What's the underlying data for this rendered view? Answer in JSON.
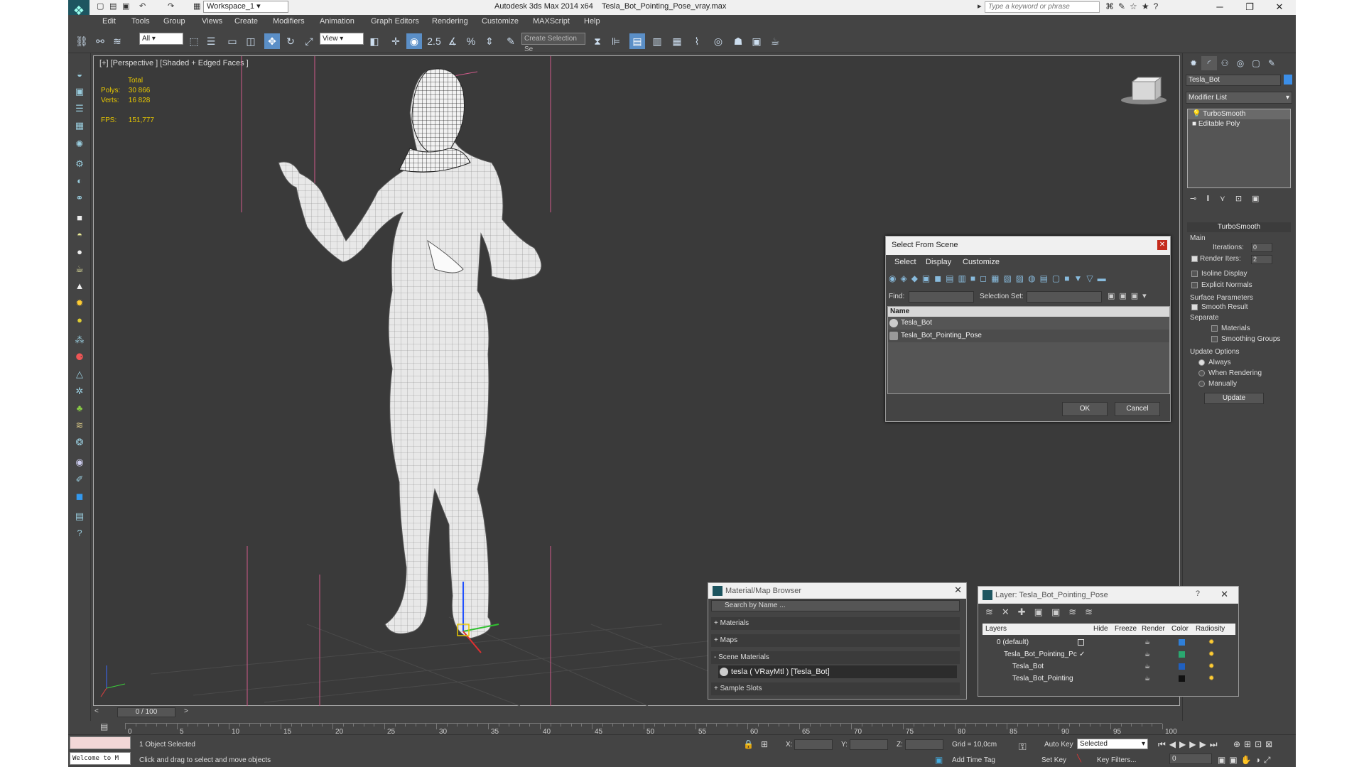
{
  "window": {
    "app_title": "Autodesk 3ds Max  2014 x64",
    "file_title": "Tesla_Bot_Pointing_Pose_vray.max",
    "workspace": "Workspace_1",
    "search_placeholder": "Type a keyword or phrase"
  },
  "menu": [
    "Edit",
    "Tools",
    "Group",
    "Views",
    "Create",
    "Modifiers",
    "Animation",
    "Graph Editors",
    "Rendering",
    "Customize",
    "MAXScript",
    "Help"
  ],
  "toolbar": {
    "selection_filter": "All",
    "ref_coord": "View",
    "create_selection_set": "Create Selection Se",
    "snap_label": "2.5"
  },
  "viewport": {
    "label": "[+] [Perspective ] [Shaded + Edged Faces ]",
    "stats_title": "Total",
    "polys_label": "Polys:",
    "polys_value": "30 866",
    "verts_label": "Verts:",
    "verts_value": "16 828",
    "fps_label": "FPS:",
    "fps_value": "151,777"
  },
  "command_panel": {
    "object_name": "Tesla_Bot",
    "object_color": "#3b8ee8",
    "modifier_list": "Modifier List",
    "stack": [
      "TurboSmooth",
      "Editable Poly"
    ],
    "rollout_title": "TurboSmooth",
    "main_label": "Main",
    "iterations_label": "Iterations:",
    "iterations_value": "0",
    "render_iters_label": "Render Iters:",
    "render_iters_value": "2",
    "isoline_display": "Isoline Display",
    "explicit_normals": "Explicit Normals",
    "surface_params": "Surface Parameters",
    "smooth_result": "Smooth Result",
    "separate": "Separate",
    "materials": "Materials",
    "smoothing_groups": "Smoothing Groups",
    "update_options": "Update Options",
    "always": "Always",
    "when_rendering": "When Rendering",
    "manually": "Manually",
    "update_button": "Update"
  },
  "select_from_scene": {
    "title": "Select From Scene",
    "menu": [
      "Select",
      "Display",
      "Customize"
    ],
    "find_label": "Find:",
    "selection_set_label": "Selection Set:",
    "column_name": "Name",
    "rows": [
      "Tesla_Bot",
      "Tesla_Bot_Pointing_Pose"
    ],
    "ok": "OK",
    "cancel": "Cancel"
  },
  "material_browser": {
    "title": "Material/Map Browser",
    "search_placeholder": "Search by Name ...",
    "sections": [
      "+ Materials",
      "+ Maps",
      "- Scene Materials"
    ],
    "scene_material": "tesla  ( VRayMtl ) [Tesla_Bot]",
    "sample_slots": "+ Sample Slots"
  },
  "layer_dialog": {
    "title": "Layer: Tesla_Bot_Pointing_Pose",
    "help": "?",
    "columns": [
      "Layers",
      "Hide",
      "Freeze",
      "Render",
      "Color",
      "Radiosity"
    ],
    "rows": [
      {
        "name": "0 (default)",
        "color": "#2f7fd8"
      },
      {
        "name": "Tesla_Bot_Pointing_Pc",
        "color": "#2aa870"
      },
      {
        "name": "Tesla_Bot",
        "color": "#2060c0"
      },
      {
        "name": "Tesla_Bot_Pointing",
        "color": "#111111"
      }
    ]
  },
  "timeline": {
    "frame": "0 / 100",
    "ticks": [
      "0",
      "5",
      "10",
      "15",
      "20",
      "25",
      "30",
      "35",
      "40",
      "45",
      "50",
      "55",
      "60",
      "65",
      "70",
      "75",
      "80",
      "85",
      "90",
      "95",
      "100"
    ]
  },
  "status": {
    "selected": "1 Object Selected",
    "hint": "Click and drag to select and move objects",
    "welcome": "Welcome to M",
    "x_label": "X:",
    "y_label": "Y:",
    "z_label": "Z:",
    "grid": "Grid = 10,0cm",
    "auto_key": "Auto Key",
    "set_key": "Set Key",
    "selected_dropdown": "Selected",
    "add_time_tag": "Add Time Tag",
    "key_filters": "Key Filters...",
    "frame_field": "0"
  }
}
